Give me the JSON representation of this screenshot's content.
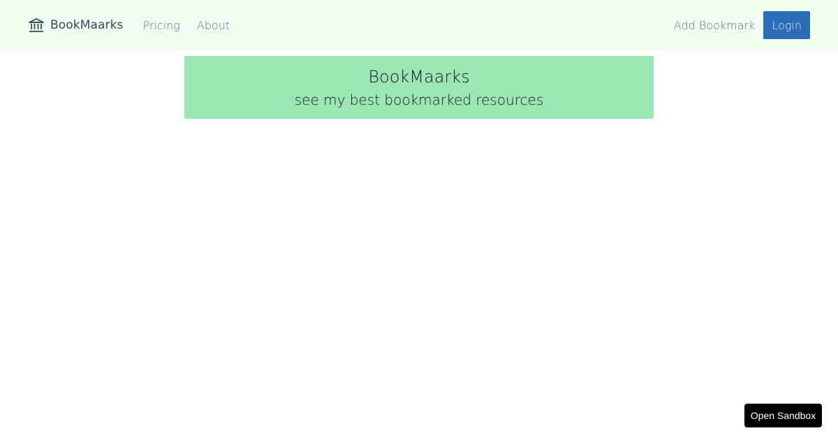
{
  "navbar": {
    "brand": {
      "icon": "bank-building-icon",
      "name": "BookMaarks"
    },
    "links": [
      {
        "label": "Pricing"
      },
      {
        "label": "About"
      }
    ],
    "add_bookmark_label": "Add Bookmark",
    "login_label": "Login"
  },
  "hero": {
    "title": "BookMaarks",
    "subtitle": "see my best bookmarked resources"
  },
  "sandbox": {
    "label": "Open Sandbox"
  },
  "colors": {
    "navbar_background": "#effdf1",
    "hero_background": "#9ae6b4",
    "login_button": "#2b6cb6",
    "sandbox_button": "#000000"
  }
}
